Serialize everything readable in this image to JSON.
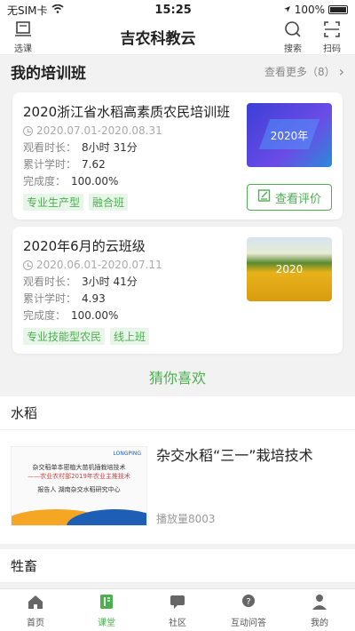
{
  "status": {
    "carrier": "无SIM卡",
    "time": "15:25",
    "battery": "100%"
  },
  "nav": {
    "title": "吉农科教云",
    "left_label": "选课",
    "search_label": "搜索",
    "scan_label": "扫码"
  },
  "training": {
    "title": "我的培训班",
    "see_more": "查看更多（8）",
    "cards": [
      {
        "title": "2020浙江省水稻高素质农民培训班",
        "date": "2020.07.01-2020.08.31",
        "watch_label": "观看时长：",
        "watch_value": "8小时 31分",
        "hours_label": "累计学时：",
        "hours_value": "7.62",
        "done_label": "完成度：",
        "done_value": "100.00%",
        "tags": [
          "专业生产型",
          "融合班"
        ],
        "thumb_text": "2020年",
        "eval_label": "查看评价"
      },
      {
        "title": "2020年6月的云班级",
        "date": "2020.06.01-2020.07.11",
        "watch_label": "观看时长：",
        "watch_value": "3小时 41分",
        "hours_label": "累计学时：",
        "hours_value": "4.93",
        "done_label": "完成度：",
        "done_value": "100.00%",
        "tags": [
          "专业技能型农民",
          "线上班"
        ],
        "thumb_text": "2020"
      }
    ]
  },
  "guess": {
    "title": "猜你喜欢"
  },
  "rice": {
    "title": "水稻",
    "video": {
      "title": "杂交水稻“三一”栽培技术",
      "plays": "播放量8003",
      "thumb_logo": "LONGPING",
      "thumb_line1": "杂交稻单本密植大苗机插栽培技术",
      "thumb_line2": "——农业农村部2019年农业主推技术",
      "thumb_line3": "报告人 湖南杂交水稻研究中心"
    }
  },
  "livestock": {
    "title": "牲畜"
  },
  "tabs": [
    {
      "label": "首页",
      "icon": "home-icon"
    },
    {
      "label": "课堂",
      "icon": "classroom-icon"
    },
    {
      "label": "社区",
      "icon": "community-icon"
    },
    {
      "label": "互动问答",
      "icon": "qa-icon"
    },
    {
      "label": "我的",
      "icon": "profile-icon"
    }
  ],
  "colors": {
    "accent": "#4caf50",
    "background": "#f2f2f2"
  }
}
